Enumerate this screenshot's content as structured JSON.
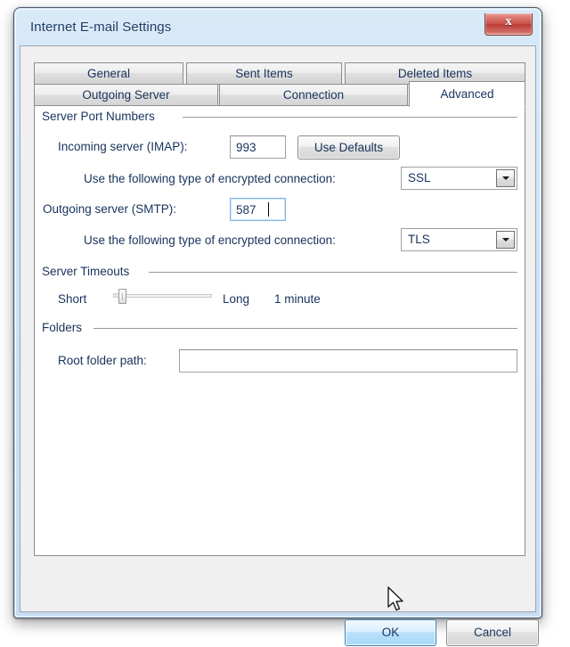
{
  "window": {
    "title": "Internet E-mail Settings",
    "close_button_label": "x",
    "close_button_icon": "close-icon",
    "accent_color": "#17335c",
    "frame_color": "#cfe3f6",
    "close_button_color": "#c9524b"
  },
  "tabs": {
    "row1": [
      {
        "label": "General",
        "selected": false
      },
      {
        "label": "Sent Items",
        "selected": false
      },
      {
        "label": "Deleted Items",
        "selected": false
      }
    ],
    "row2": [
      {
        "label": "Outgoing Server",
        "selected": false
      },
      {
        "label": "Connection",
        "selected": false
      },
      {
        "label": "Advanced",
        "selected": true
      }
    ]
  },
  "advanced": {
    "server_port_numbers": {
      "group_label": "Server Port Numbers",
      "incoming_label": "Incoming server (IMAP):",
      "incoming_value": "993",
      "incoming_placeholder": "",
      "use_defaults_label": "Use Defaults",
      "incoming_encryption_label": "Use the following type of encrypted connection:",
      "incoming_encryption_value": "SSL",
      "outgoing_label": "Outgoing server (SMTP):",
      "outgoing_value": "587",
      "outgoing_placeholder": "",
      "outgoing_encryption_label": "Use the following type of encrypted connection:",
      "outgoing_encryption_value": "TLS"
    },
    "server_timeouts": {
      "group_label": "Server Timeouts",
      "short_label": "Short",
      "long_label": "Long",
      "value_label": "1 minute"
    },
    "folders": {
      "group_label": "Folders",
      "root_folder_label": "Root folder path:",
      "root_folder_value": "",
      "root_folder_placeholder": ""
    }
  },
  "footer": {
    "ok_label": "OK",
    "cancel_label": "Cancel"
  },
  "cursor": {
    "icon": "mouse-pointer-icon"
  }
}
